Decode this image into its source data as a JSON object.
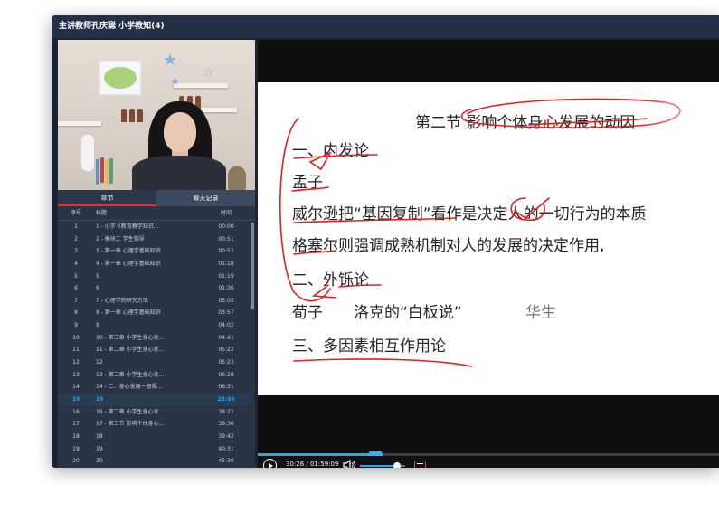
{
  "window": {
    "title": "主讲教师孔庆聪 小学教知(4)"
  },
  "tabs": [
    {
      "label": "章节",
      "active": true
    },
    {
      "label": "聊天记录",
      "active": false
    }
  ],
  "list": {
    "headers": {
      "num": "序号",
      "title": "标题",
      "time": "时间"
    },
    "rows": [
      {
        "num": "1",
        "title": "1 - 小学《教育教学知识...",
        "time": "00:00"
      },
      {
        "num": "2",
        "title": "2 - 模块二 学生指导",
        "time": "00:51"
      },
      {
        "num": "3",
        "title": "3 - 第一章 心理学基础知识",
        "time": "00:52"
      },
      {
        "num": "4",
        "title": "4 - 第一章 心理学基础知识",
        "time": "01:18"
      },
      {
        "num": "5",
        "title": "5",
        "time": "01:19"
      },
      {
        "num": "6",
        "title": "6",
        "time": "01:36"
      },
      {
        "num": "7",
        "title": "7 - 心理学的研究方法",
        "time": "03:05"
      },
      {
        "num": "8",
        "title": "8 - 第一章 心理学基础知识",
        "time": "03:57"
      },
      {
        "num": "9",
        "title": "9",
        "time": "04:02"
      },
      {
        "num": "10",
        "title": "10 - 第二章 小学生身心发...",
        "time": "04:41"
      },
      {
        "num": "11",
        "title": "11 - 第二章 小学生身心发...",
        "time": "05:22"
      },
      {
        "num": "12",
        "title": "12",
        "time": "05:23"
      },
      {
        "num": "13",
        "title": "13 - 第二章 小学生身心发...",
        "time": "06:28"
      },
      {
        "num": "14",
        "title": "14 - 二、身心发展一般规...",
        "time": "06:31"
      },
      {
        "num": "15",
        "title": "15",
        "time": "25:36",
        "active": true
      },
      {
        "num": "16",
        "title": "16 - 第二章 小学生身心发...",
        "time": "38:22"
      },
      {
        "num": "17",
        "title": "17 - 第三节 影响个体身心...",
        "time": "38:30"
      },
      {
        "num": "18",
        "title": "18",
        "time": "39:42"
      },
      {
        "num": "19",
        "title": "19",
        "time": "40:31"
      },
      {
        "num": "20",
        "title": "20",
        "time": "45:30"
      }
    ]
  },
  "slide": {
    "heading": "第二节 影响个体身心发展的动因",
    "lines": [
      {
        "text": "一、内发论"
      },
      {
        "text": "孟子"
      },
      {
        "text": "威尔逊把“基因复制”看作是决定人的一切行为的本质"
      },
      {
        "text": "格塞尔则强调成熟机制对人的发展的决定作用,"
      },
      {
        "text": "二、外铄论"
      },
      {
        "text": "荀子　　洛克的“白板说”"
      },
      {
        "text": "华生"
      },
      {
        "text": "三、多因素相互作用论"
      }
    ],
    "ink_color": "#e02020"
  },
  "player": {
    "time": "30:26 / 01:59:09",
    "progress": 0.255,
    "volume": 0.82,
    "accent_color": "#2aa8e6",
    "icons": [
      "play-icon",
      "volume-icon",
      "screenshot-icon"
    ]
  }
}
